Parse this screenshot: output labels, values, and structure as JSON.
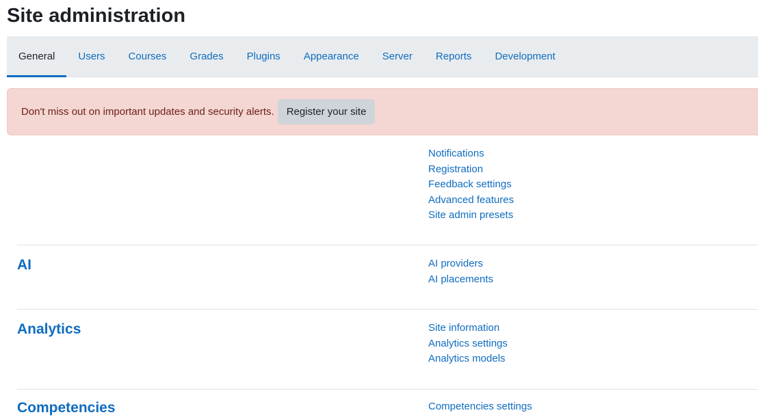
{
  "page": {
    "title": "Site administration"
  },
  "tabs": [
    {
      "label": "General",
      "active": true
    },
    {
      "label": "Users"
    },
    {
      "label": "Courses"
    },
    {
      "label": "Grades"
    },
    {
      "label": "Plugins"
    },
    {
      "label": "Appearance"
    },
    {
      "label": "Server"
    },
    {
      "label": "Reports"
    },
    {
      "label": "Development"
    }
  ],
  "alert": {
    "text": "Don't miss out on important updates and security alerts.",
    "button_label": "Register your site"
  },
  "sections": {
    "general": {
      "title": "",
      "links": [
        "Notifications",
        "Registration",
        "Feedback settings",
        "Advanced features",
        "Site admin presets"
      ]
    },
    "ai": {
      "title": "AI",
      "links": [
        "AI providers",
        "AI placements"
      ]
    },
    "analytics": {
      "title": "Analytics",
      "links": [
        "Site information",
        "Analytics settings",
        "Analytics models"
      ]
    },
    "competencies": {
      "title": "Competencies",
      "links": [
        "Competencies settings"
      ]
    }
  },
  "colors": {
    "link": "#0f6cbf",
    "tabbar_bg": "#e9ecef",
    "alert_bg": "#f4d6d2",
    "alert_text": "#6e211a",
    "button_bg": "#ced4da"
  }
}
